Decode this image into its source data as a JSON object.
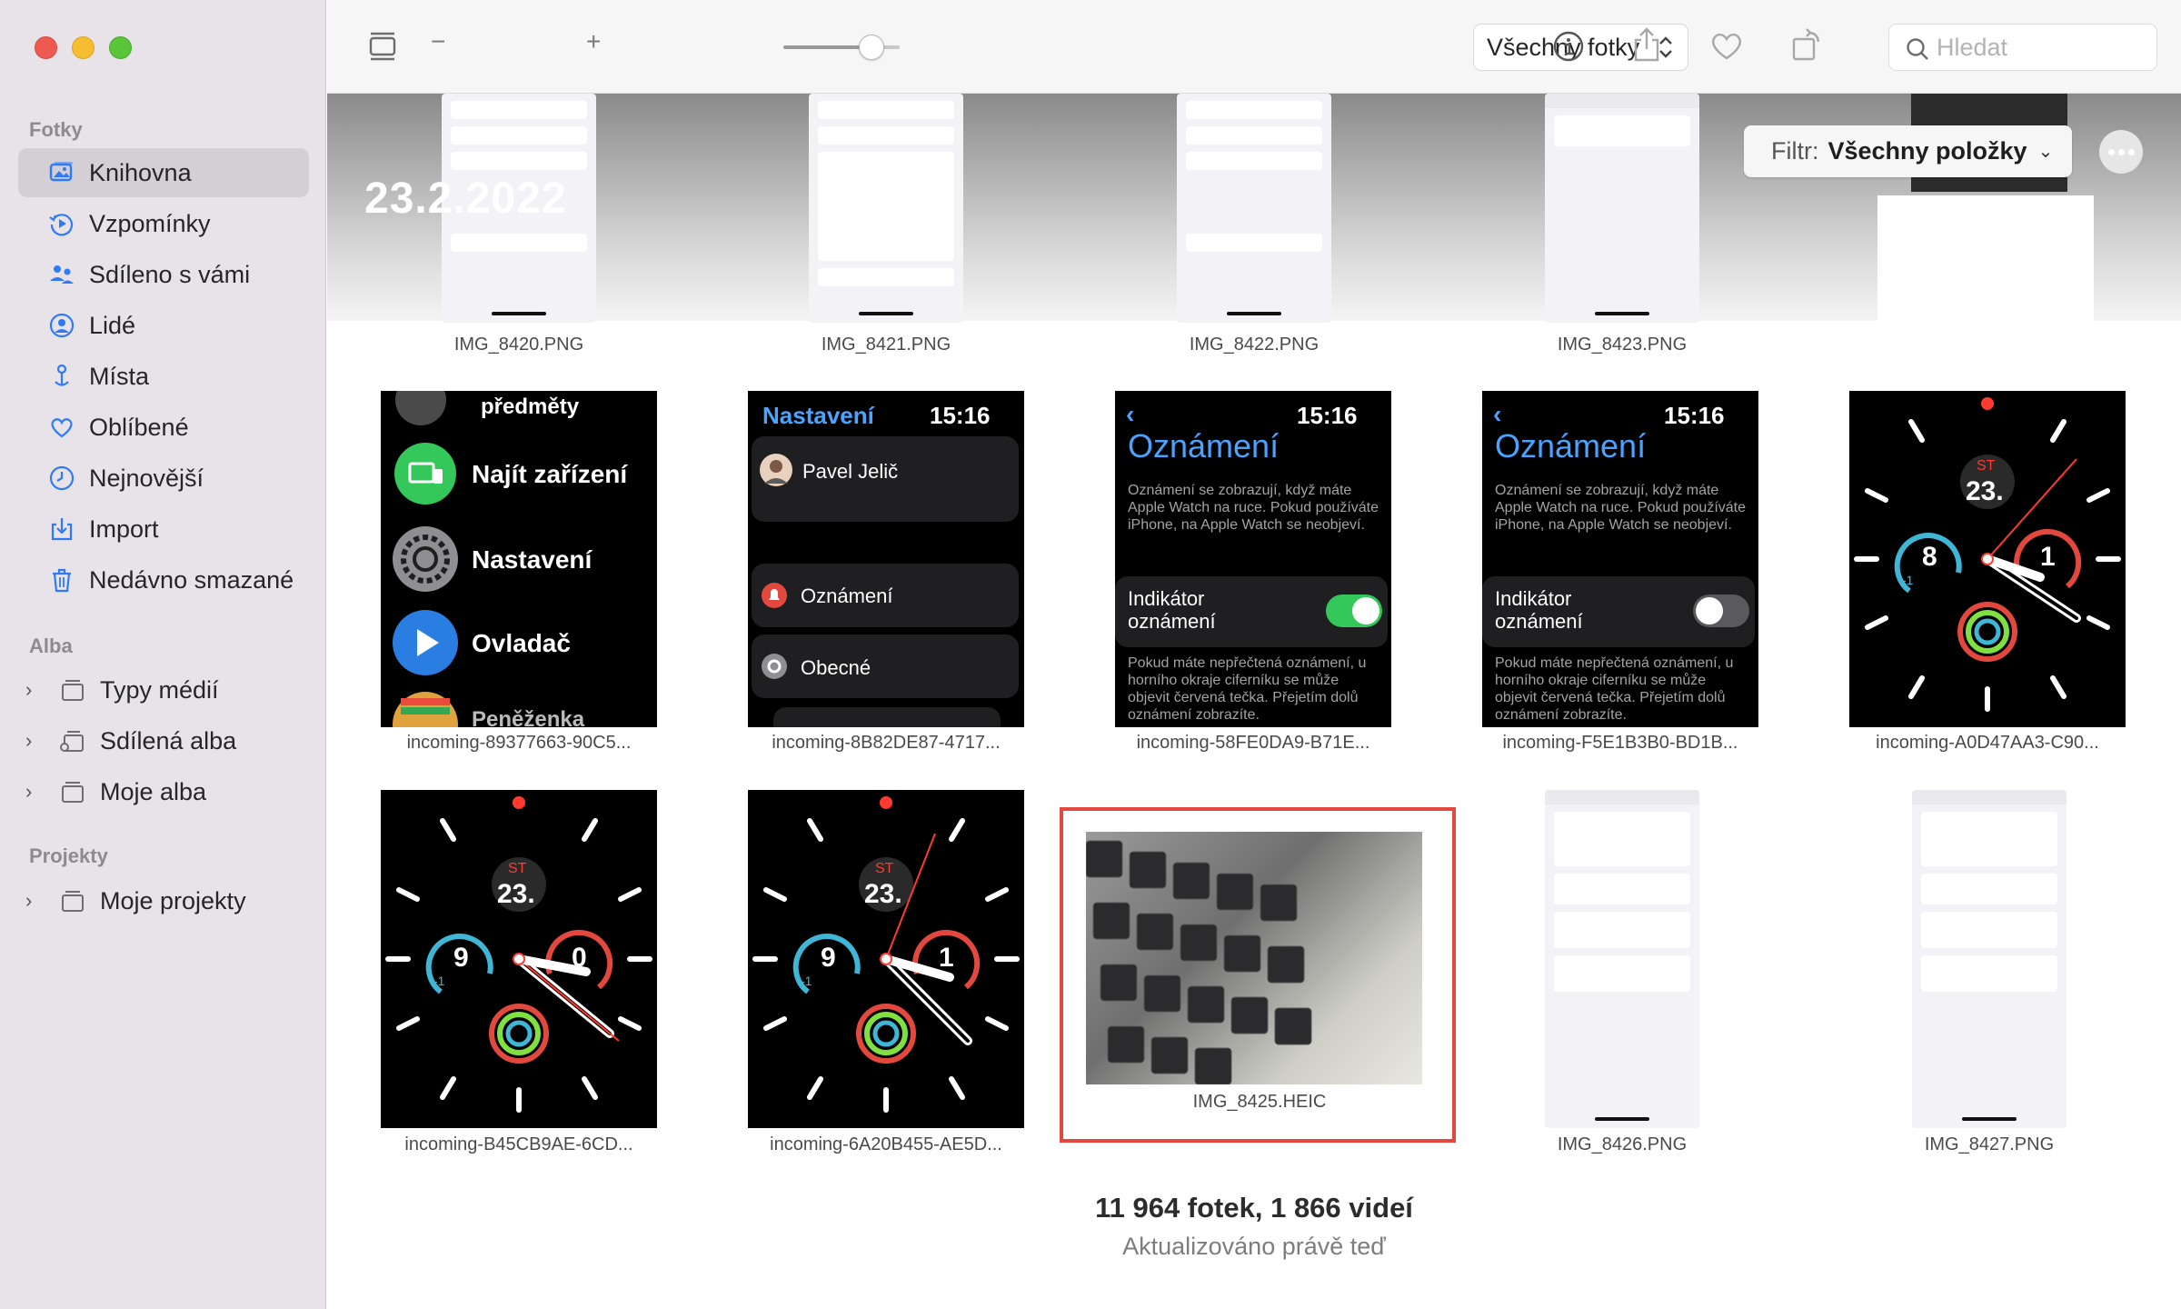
{
  "sidebar": {
    "section_photos": "Fotky",
    "items": [
      {
        "label": "Knihovna",
        "icon": "library-icon",
        "active": true
      },
      {
        "label": "Vzpomínky",
        "icon": "memories-icon"
      },
      {
        "label": "Sdíleno s vámi",
        "icon": "shared-with-you-icon"
      },
      {
        "label": "Lidé",
        "icon": "people-icon"
      },
      {
        "label": "Místa",
        "icon": "places-icon"
      },
      {
        "label": "Oblíbené",
        "icon": "heart-icon"
      },
      {
        "label": "Nejnovější",
        "icon": "clock-icon"
      },
      {
        "label": "Import",
        "icon": "import-icon"
      },
      {
        "label": "Nedávno smazané",
        "icon": "trash-icon"
      }
    ],
    "section_albums": "Alba",
    "albums": [
      {
        "label": "Typy médií"
      },
      {
        "label": "Sdílená alba"
      },
      {
        "label": "Moje alba"
      }
    ],
    "section_projects": "Projekty",
    "projects": [
      {
        "label": "Moje projekty"
      }
    ]
  },
  "toolbar": {
    "zoom_minus": "−",
    "zoom_plus": "+",
    "zoom_level": 0.75,
    "view_select": "Všechny fotky",
    "search_placeholder": "Hledat"
  },
  "content": {
    "date": "23.2.2022",
    "filter_label": "Filtr:",
    "filter_value": "Všechny položky",
    "row1": [
      "IMG_8420.PNG",
      "IMG_8421.PNG",
      "IMG_8422.PNG",
      "IMG_8423.PNG"
    ],
    "row2": [
      "incoming-89377663-90C5...",
      "incoming-8B82DE87-4717...",
      "incoming-58FE0DA9-B71E...",
      "incoming-F5E1B3B0-BD1B...",
      "incoming-A0D47AA3-C90..."
    ],
    "row3": [
      "incoming-B45CB9AE-6CD...",
      "incoming-6A20B455-AE5D...",
      "IMG_8425.HEIC",
      "IMG_8426.PNG",
      "IMG_8427.PNG"
    ],
    "footer_count": "11 964 fotek, 1 866 videí",
    "footer_updated": "Aktualizováno právě teď"
  },
  "watch": {
    "menu": {
      "item1": "předměty",
      "item2": "Najít zařízení",
      "item3": "Nastavení",
      "item4": "Ovladač",
      "item5": "Peněženka"
    },
    "settings": {
      "title": "Nastavení",
      "time": "15:16",
      "user": "Pavel Jelič",
      "row1": "Oznámení",
      "row2": "Obecné"
    },
    "notif": {
      "time": "15:16",
      "title": "Oznámení",
      "desc": "Oznámení se zobrazují, když máte Apple Watch na ruce. Pokud používáte iPhone, na Apple Watch se neobjeví.",
      "toggle_label": "Indikátor oznámení",
      "footer": "Pokud máte nepřečtená oznámení, u horního okraje ciferníku se může objevit červená tečka. Přejetím dolů oznámení zobrazíte."
    },
    "faces": [
      {
        "day": "ST",
        "date": "23.",
        "left": "8",
        "left_sub": "-1",
        "right": "1"
      },
      {
        "day": "ST",
        "date": "23.",
        "left": "9",
        "left_sub": "-1",
        "right": "0"
      },
      {
        "day": "ST",
        "date": "23.",
        "left": "9",
        "left_sub": "-1",
        "right": "1"
      }
    ]
  },
  "colors": {
    "accent_red": "#e2483d",
    "toggle_on": "#34c759",
    "watch_blue": "#4aa3ff"
  }
}
